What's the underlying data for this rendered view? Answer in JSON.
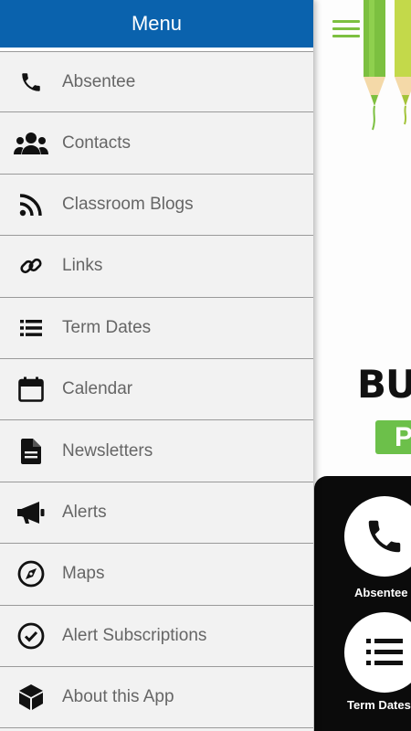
{
  "drawer": {
    "title": "Menu",
    "items": [
      {
        "label": "Absentee",
        "icon": "phone-icon"
      },
      {
        "label": "Contacts",
        "icon": "users-icon"
      },
      {
        "label": "Classroom Blogs",
        "icon": "rss-icon"
      },
      {
        "label": "Links",
        "icon": "link-icon"
      },
      {
        "label": "Term Dates",
        "icon": "list-icon"
      },
      {
        "label": "Calendar",
        "icon": "calendar-icon"
      },
      {
        "label": "Newsletters",
        "icon": "document-icon"
      },
      {
        "label": "Alerts",
        "icon": "megaphone-icon"
      },
      {
        "label": "Maps",
        "icon": "compass-icon"
      },
      {
        "label": "Alert Subscriptions",
        "icon": "check-circle-icon"
      },
      {
        "label": "About this App",
        "icon": "cube-icon"
      }
    ]
  },
  "background_app": {
    "title_partial": "BU",
    "badge_partial": "P",
    "tiles": [
      {
        "label": "Absentee",
        "icon": "phone-icon"
      },
      {
        "label": "Term Dates",
        "icon": "list-icon"
      }
    ],
    "colors": {
      "accent": "#7cc040",
      "header": "#0a62ad",
      "tile_bg": "#0b0b0b"
    }
  }
}
